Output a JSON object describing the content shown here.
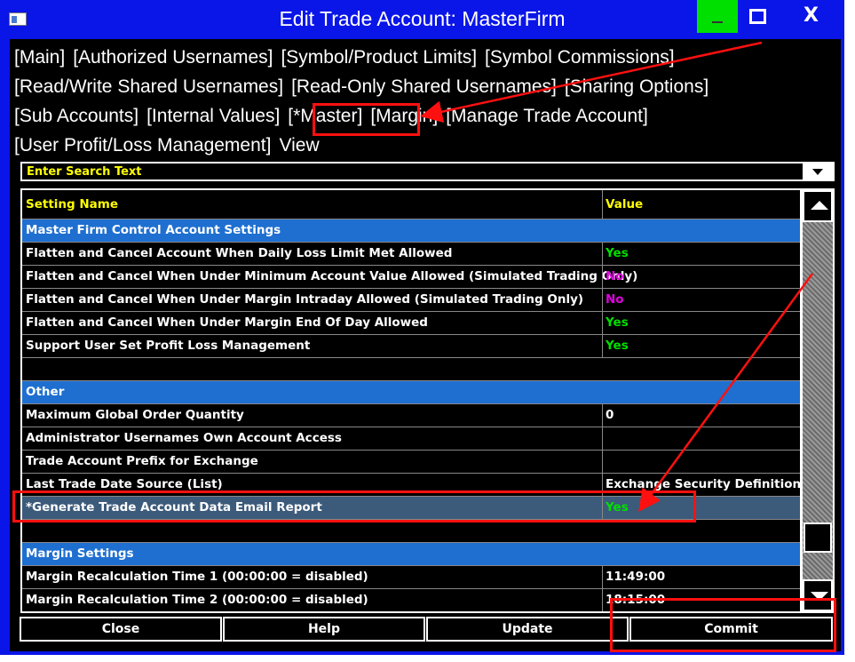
{
  "window": {
    "title": "Edit Trade Account: MasterFirm",
    "controls": {
      "minimize": "—",
      "maximize": "□",
      "close": "X"
    }
  },
  "tabs": {
    "line1": [
      "[Main]",
      "[Authorized Usernames]",
      "[Symbol/Product Limits]",
      "[Symbol Commissions]"
    ],
    "line2": [
      "[Read/Write Shared Usernames]",
      "[Read-Only Shared Usernames]",
      "[Sharing Options]"
    ],
    "line3": [
      "[Sub Accounts]",
      "[Internal Values]",
      "[*Master]",
      "[Margin]",
      "[Manage Trade Account]"
    ],
    "line4": [
      "[User Profit/Loss Management]",
      "View"
    ]
  },
  "search": {
    "placeholder": "Enter Search Text"
  },
  "table": {
    "headers": {
      "name": "Setting Name",
      "value": "Value"
    },
    "rows": [
      {
        "type": "section",
        "name": "Master Firm Control Account Settings",
        "value": ""
      },
      {
        "type": "row",
        "name": "Flatten and Cancel Account When Daily Loss Limit Met Allowed",
        "value": "Yes"
      },
      {
        "type": "row",
        "name": "Flatten and Cancel When Under Minimum Account Value Allowed (Simulated Trading Only)",
        "value": "No"
      },
      {
        "type": "row",
        "name": "Flatten and Cancel When Under Margin Intraday Allowed (Simulated Trading Only)",
        "value": "No"
      },
      {
        "type": "row",
        "name": "Flatten and Cancel When Under Margin End Of Day Allowed",
        "value": "Yes"
      },
      {
        "type": "row",
        "name": "Support User Set Profit Loss Management",
        "value": "Yes"
      },
      {
        "type": "blank",
        "name": "",
        "value": ""
      },
      {
        "type": "section",
        "name": "Other",
        "value": ""
      },
      {
        "type": "row",
        "name": "Maximum Global Order Quantity",
        "value": "0"
      },
      {
        "type": "row",
        "name": "Administrator Usernames Own Account Access",
        "value": ""
      },
      {
        "type": "row",
        "name": "Trade Account Prefix for Exchange",
        "value": ""
      },
      {
        "type": "row",
        "name": "Last Trade Date Source (List)",
        "value": "Exchange Security Definition"
      },
      {
        "type": "selected",
        "name": "*Generate Trade Account Data Email Report",
        "value": "Yes"
      },
      {
        "type": "blank",
        "name": "",
        "value": ""
      },
      {
        "type": "section",
        "name": "Margin Settings",
        "value": ""
      },
      {
        "type": "row",
        "name": "Margin Recalculation Time 1 (00:00:00 = disabled)",
        "value": "11:49:00"
      },
      {
        "type": "row",
        "name": "Margin Recalculation Time 2 (00:00:00 = disabled)",
        "value": "18:15:00"
      }
    ]
  },
  "buttons": {
    "close": "Close",
    "help": "Help",
    "update": "Update",
    "commit": "Commit"
  },
  "colors": {
    "window_border": "#0a15e8",
    "section": "#1e6fd0",
    "yes": "#00e000",
    "no": "#e000e0",
    "annotation": "#ff1010"
  }
}
